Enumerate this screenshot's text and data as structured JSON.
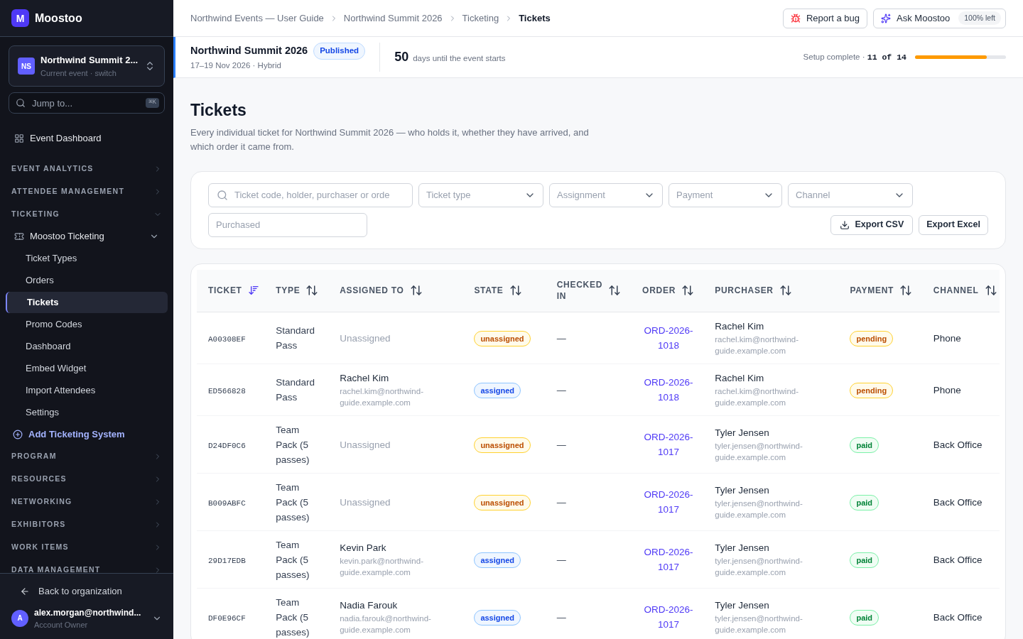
{
  "brand": {
    "initial": "M",
    "name": "Moostoo"
  },
  "event_switcher": {
    "initials": "NS",
    "name": "Northwind Summit 2...",
    "subtitle": "Current event · switch"
  },
  "jump": {
    "placeholder": "Jump to...",
    "shortcut": "⌘K"
  },
  "dashboard_link": "Event Dashboard",
  "nav_sections": [
    {
      "label": "EVENT ANALYTICS",
      "expanded": false
    },
    {
      "label": "ATTENDEE MANAGEMENT",
      "expanded": false
    },
    {
      "label": "TICKETING",
      "expanded": true,
      "group": {
        "label": "Moostoo Ticketing",
        "expanded": true,
        "items": [
          {
            "label": "Ticket Types",
            "selected": false
          },
          {
            "label": "Orders",
            "selected": false
          },
          {
            "label": "Tickets",
            "selected": true
          },
          {
            "label": "Promo Codes",
            "selected": false
          },
          {
            "label": "Dashboard",
            "selected": false
          },
          {
            "label": "Embed Widget",
            "selected": false
          },
          {
            "label": "Import Attendees",
            "selected": false
          },
          {
            "label": "Settings",
            "selected": false
          }
        ]
      },
      "add_link": "Add Ticketing System"
    },
    {
      "label": "PROGRAM",
      "expanded": false
    },
    {
      "label": "RESOURCES",
      "expanded": false
    },
    {
      "label": "NETWORKING",
      "expanded": false
    },
    {
      "label": "EXHIBITORS",
      "expanded": false
    },
    {
      "label": "WORK ITEMS",
      "expanded": false
    },
    {
      "label": "DATA MANAGEMENT",
      "expanded": false
    }
  ],
  "back_link": "Back to organization",
  "account": {
    "initial": "A",
    "email": "alex.morgan@northwind...",
    "role": "Account Owner"
  },
  "breadcrumbs": [
    "Northwind Events — User Guide",
    "Northwind Summit 2026",
    "Ticketing",
    "Tickets"
  ],
  "report_bug": "Report a bug",
  "ask": {
    "label": "Ask Moostoo",
    "quota": "100% left"
  },
  "event": {
    "name": "Northwind Summit 2026",
    "status": "Published",
    "dates": "17–19 Nov 2026 · Hybrid",
    "days": "50",
    "days_text": "days until the event starts"
  },
  "setup": {
    "label": "Setup complete · ",
    "done": "11",
    "of": "of",
    "total": "14",
    "level": 0.79
  },
  "page": {
    "title": "Tickets",
    "description": "Every individual ticket for Northwind Summit 2026 — who holds it, whether they have arrived, and which order it came from."
  },
  "filters": {
    "search_placeholder": "Ticket code, holder, purchaser or orde",
    "selects": [
      "Ticket type",
      "Assignment",
      "Payment",
      "Channel"
    ],
    "purchased_placeholder": "Purchased",
    "export_csv": "Export CSV",
    "export_excel": "Export Excel"
  },
  "table": {
    "columns": [
      {
        "label": "TICKET",
        "sorted": true
      },
      {
        "label": "TYPE",
        "sorted": false
      },
      {
        "label": "ASSIGNED TO",
        "sorted": false
      },
      {
        "label": "STATE",
        "sorted": false
      },
      {
        "label": "CHECKED IN",
        "sorted": false
      },
      {
        "label": "ORDER",
        "sorted": false
      },
      {
        "label": "PURCHASER",
        "sorted": false
      },
      {
        "label": "PAYMENT",
        "sorted": false
      },
      {
        "label": "CHANNEL",
        "sorted": false
      }
    ],
    "rows": [
      {
        "ticket": "A00308EF",
        "type": "Standard Pass",
        "assignee": {
          "kind": "empty",
          "name": "Unassigned"
        },
        "state": {
          "kind": "unassigned",
          "label": "unassigned"
        },
        "checked_in": "—",
        "order": "ORD-2026-1018",
        "purchaser": {
          "name": "Rachel Kim",
          "email": "rachel.kim@northwind-guide.example.com"
        },
        "payment": {
          "kind": "pending",
          "label": "pending"
        },
        "channel": "Phone"
      },
      {
        "ticket": "ED566828",
        "type": "Standard Pass",
        "assignee": {
          "kind": "person",
          "name": "Rachel Kim",
          "email": "rachel.kim@northwind-guide.example.com"
        },
        "state": {
          "kind": "assigned",
          "label": "assigned"
        },
        "checked_in": "—",
        "order": "ORD-2026-1018",
        "purchaser": {
          "name": "Rachel Kim",
          "email": "rachel.kim@northwind-guide.example.com"
        },
        "payment": {
          "kind": "pending",
          "label": "pending"
        },
        "channel": "Phone"
      },
      {
        "ticket": "D24DF0C6",
        "type": "Team Pack (5 passes)",
        "assignee": {
          "kind": "empty",
          "name": "Unassigned"
        },
        "state": {
          "kind": "unassigned",
          "label": "unassigned"
        },
        "checked_in": "—",
        "order": "ORD-2026-1017",
        "purchaser": {
          "name": "Tyler Jensen",
          "email": "tyler.jensen@northwind-guide.example.com"
        },
        "payment": {
          "kind": "paid",
          "label": "paid"
        },
        "channel": "Back Office"
      },
      {
        "ticket": "B009ABFC",
        "type": "Team Pack (5 passes)",
        "assignee": {
          "kind": "empty",
          "name": "Unassigned"
        },
        "state": {
          "kind": "unassigned",
          "label": "unassigned"
        },
        "checked_in": "—",
        "order": "ORD-2026-1017",
        "purchaser": {
          "name": "Tyler Jensen",
          "email": "tyler.jensen@northwind-guide.example.com"
        },
        "payment": {
          "kind": "paid",
          "label": "paid"
        },
        "channel": "Back Office"
      },
      {
        "ticket": "29D17EDB",
        "type": "Team Pack (5 passes)",
        "assignee": {
          "kind": "person",
          "name": "Kevin Park",
          "email": "kevin.park@northwind-guide.example.com"
        },
        "state": {
          "kind": "assigned",
          "label": "assigned"
        },
        "checked_in": "—",
        "order": "ORD-2026-1017",
        "purchaser": {
          "name": "Tyler Jensen",
          "email": "tyler.jensen@northwind-guide.example.com"
        },
        "payment": {
          "kind": "paid",
          "label": "paid"
        },
        "channel": "Back Office"
      },
      {
        "ticket": "DF0E96CF",
        "type": "Team Pack (5 passes)",
        "assignee": {
          "kind": "person",
          "name": "Nadia Farouk",
          "email": "nadia.farouk@northwind-guide.example.com"
        },
        "state": {
          "kind": "assigned",
          "label": "assigned"
        },
        "checked_in": "—",
        "order": "ORD-2026-1017",
        "purchaser": {
          "name": "Tyler Jensen",
          "email": "tyler.jensen@northwind-guide.example.com"
        },
        "payment": {
          "kind": "paid",
          "label": "paid"
        },
        "channel": "Back Office"
      }
    ]
  }
}
